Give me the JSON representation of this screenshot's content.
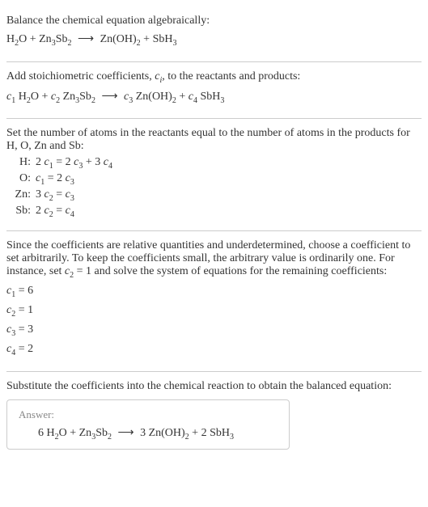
{
  "section1": {
    "title": "Balance the chemical equation algebraically:",
    "eq_lhs_1": "H",
    "eq_lhs_1_sub": "2",
    "eq_lhs_2": "O + Zn",
    "eq_lhs_2_sub": "3",
    "eq_lhs_3": "Sb",
    "eq_lhs_3_sub": "2",
    "arrow": "⟶",
    "eq_rhs_1": "Zn(OH)",
    "eq_rhs_1_sub": "2",
    "eq_rhs_2": " + SbH",
    "eq_rhs_2_sub": "3"
  },
  "section2": {
    "title_a": "Add stoichiometric coefficients, ",
    "title_ci": "c",
    "title_ci_sub": "i",
    "title_b": ", to the reactants and products:",
    "c1": "c",
    "c1_sub": "1",
    "sp1": " H",
    "sp1_sub": "2",
    "sp1b": "O + ",
    "c2": "c",
    "c2_sub": "2",
    "sp2": " Zn",
    "sp2_sub": "3",
    "sp2b": "Sb",
    "sp2c_sub": "2",
    "arrow": "⟶",
    "c3": "c",
    "c3_sub": "3",
    "sp3": " Zn(OH)",
    "sp3_sub": "2",
    "sp3b": " + ",
    "c4": "c",
    "c4_sub": "4",
    "sp4": " SbH",
    "sp4_sub": "3"
  },
  "section3": {
    "title": "Set the number of atoms in the reactants equal to the number of atoms in the products for H, O, Zn and Sb:",
    "rows": [
      {
        "el": "H:",
        "lhs_a": "2 ",
        "c_a": "c",
        "c_a_sub": "1",
        "mid": " = 2 ",
        "c_b": "c",
        "c_b_sub": "3",
        "mid2": " + 3 ",
        "c_c": "c",
        "c_c_sub": "4"
      },
      {
        "el": "O:",
        "lhs_a": "",
        "c_a": "c",
        "c_a_sub": "1",
        "mid": " = 2 ",
        "c_b": "c",
        "c_b_sub": "3",
        "mid2": "",
        "c_c": "",
        "c_c_sub": ""
      },
      {
        "el": "Zn:",
        "lhs_a": "3 ",
        "c_a": "c",
        "c_a_sub": "2",
        "mid": " = ",
        "c_b": "c",
        "c_b_sub": "3",
        "mid2": "",
        "c_c": "",
        "c_c_sub": ""
      },
      {
        "el": "Sb:",
        "lhs_a": "2 ",
        "c_a": "c",
        "c_a_sub": "2",
        "mid": " = ",
        "c_b": "c",
        "c_b_sub": "4",
        "mid2": "",
        "c_c": "",
        "c_c_sub": ""
      }
    ]
  },
  "section4": {
    "title_a": "Since the coefficients are relative quantities and underdetermined, choose a coefficient to set arbitrarily. To keep the coefficients small, the arbitrary value is ordinarily one. For instance, set ",
    "title_c": "c",
    "title_c_sub": "2",
    "title_eq": " = 1 and solve the system of equations for the remaining coefficients:",
    "lines": [
      {
        "c": "c",
        "sub": "1",
        "val": " = 6"
      },
      {
        "c": "c",
        "sub": "2",
        "val": " = 1"
      },
      {
        "c": "c",
        "sub": "3",
        "val": " = 3"
      },
      {
        "c": "c",
        "sub": "4",
        "val": " = 2"
      }
    ]
  },
  "section5": {
    "title": "Substitute the coefficients into the chemical reaction to obtain the balanced equation:",
    "answer_label": "Answer:",
    "eq_a": "6 H",
    "eq_a_sub": "2",
    "eq_b": "O + Zn",
    "eq_b_sub": "3",
    "eq_c": "Sb",
    "eq_c_sub": "2",
    "arrow": "⟶",
    "eq_d": "3 Zn(OH)",
    "eq_d_sub": "2",
    "eq_e": " + 2 SbH",
    "eq_e_sub": "3"
  }
}
